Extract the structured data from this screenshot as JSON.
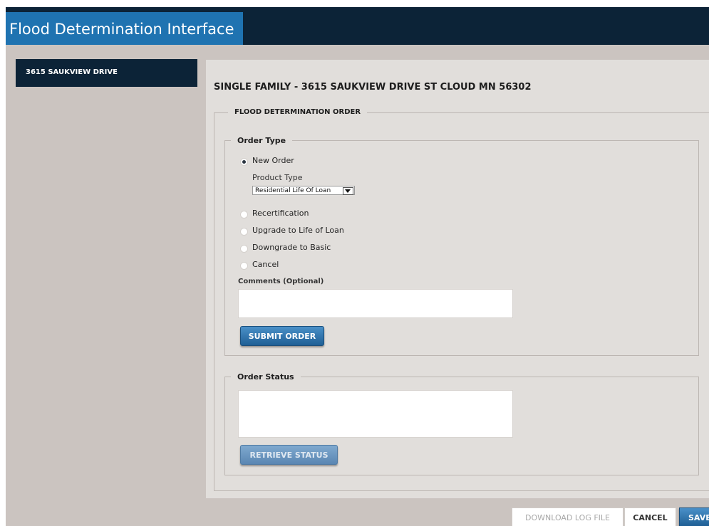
{
  "app": {
    "title": "Flood Determination Interface"
  },
  "sidebar": {
    "items": [
      {
        "label": "3615 SAUKVIEW DRIVE"
      }
    ]
  },
  "main": {
    "property_title": "SINGLE FAMILY - 3615 SAUKVIEW DRIVE ST CLOUD MN 56302",
    "order_section": {
      "legend": "FLOOD DETERMINATION ORDER",
      "order_type": {
        "legend": "Order Type",
        "options": [
          {
            "label": "New Order",
            "selected": true
          },
          {
            "label": "Recertification",
            "selected": false
          },
          {
            "label": "Upgrade to Life of Loan",
            "selected": false
          },
          {
            "label": "Downgrade to Basic",
            "selected": false
          },
          {
            "label": "Cancel",
            "selected": false
          }
        ],
        "product_type_label": "Product Type",
        "product_type_value": "Residential Life Of Loan",
        "comments_label": "Comments (Optional)",
        "comments_value": "",
        "submit_label": "SUBMIT ORDER"
      },
      "order_status": {
        "legend": "Order Status",
        "status_value": "",
        "retrieve_label": "RETRIEVE STATUS"
      }
    }
  },
  "footer": {
    "download_log_label": "DOWNLOAD LOG FILE",
    "cancel_label": "CANCEL",
    "save_label": "SAVE"
  },
  "colors": {
    "header_bg": "#0c2337",
    "title_tab_bg": "#1f73b1",
    "frame_bg": "#cbc4c0",
    "panel_bg": "#e1dedb",
    "button_blue": "#1f5f95"
  }
}
